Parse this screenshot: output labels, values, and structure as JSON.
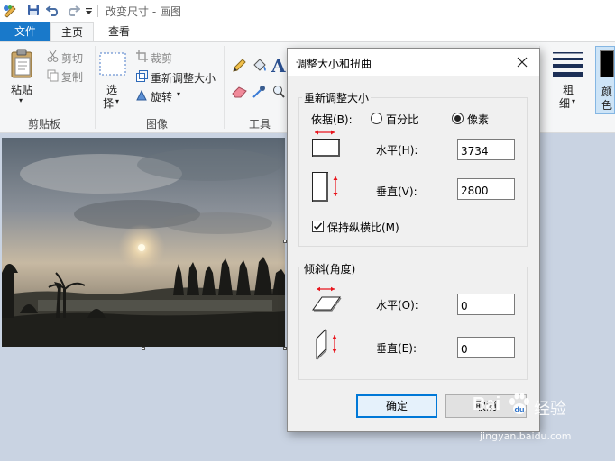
{
  "window": {
    "title": "改变尺寸 - 画图"
  },
  "tabs": {
    "file": "文件",
    "home": "主页",
    "view": "查看"
  },
  "ribbon": {
    "clipboard": {
      "paste": "粘贴",
      "cut": "剪切",
      "copy": "复制",
      "label": "剪贴板"
    },
    "image": {
      "select_top": "选",
      "select_bottom": "择",
      "crop": "裁剪",
      "resize": "重新调整大小",
      "rotate": "旋转",
      "label": "图像"
    },
    "tools": {
      "label": "工具"
    },
    "size": {
      "top": "粗",
      "bottom": "细"
    },
    "color": {
      "top": "颜",
      "bottom": "色"
    }
  },
  "dialog": {
    "title": "调整大小和扭曲",
    "resize": {
      "legend": "重新调整大小",
      "by_label": "依据(B):",
      "percent_label": "百分比",
      "pixels_label": "像素",
      "selected": "pixels",
      "horizontal_label": "水平(H):",
      "horizontal_value": "3734",
      "vertical_label": "垂直(V):",
      "vertical_value": "2800",
      "keep_ratio_label": "保持纵横比(M)",
      "keep_ratio_checked": true
    },
    "skew": {
      "legend": "倾斜(角度)",
      "horizontal_label": "水平(O):",
      "horizontal_value": "0",
      "vertical_label": "垂直(E):",
      "vertical_value": "0"
    },
    "ok_label": "确定",
    "cancel_label": "取消"
  },
  "watermark": {
    "brand": "Bai",
    "brand2": "经验",
    "url": "jingyan.baidu.com"
  },
  "colors": {
    "accent": "#1979ca",
    "arrow_red": "#e8141c"
  }
}
